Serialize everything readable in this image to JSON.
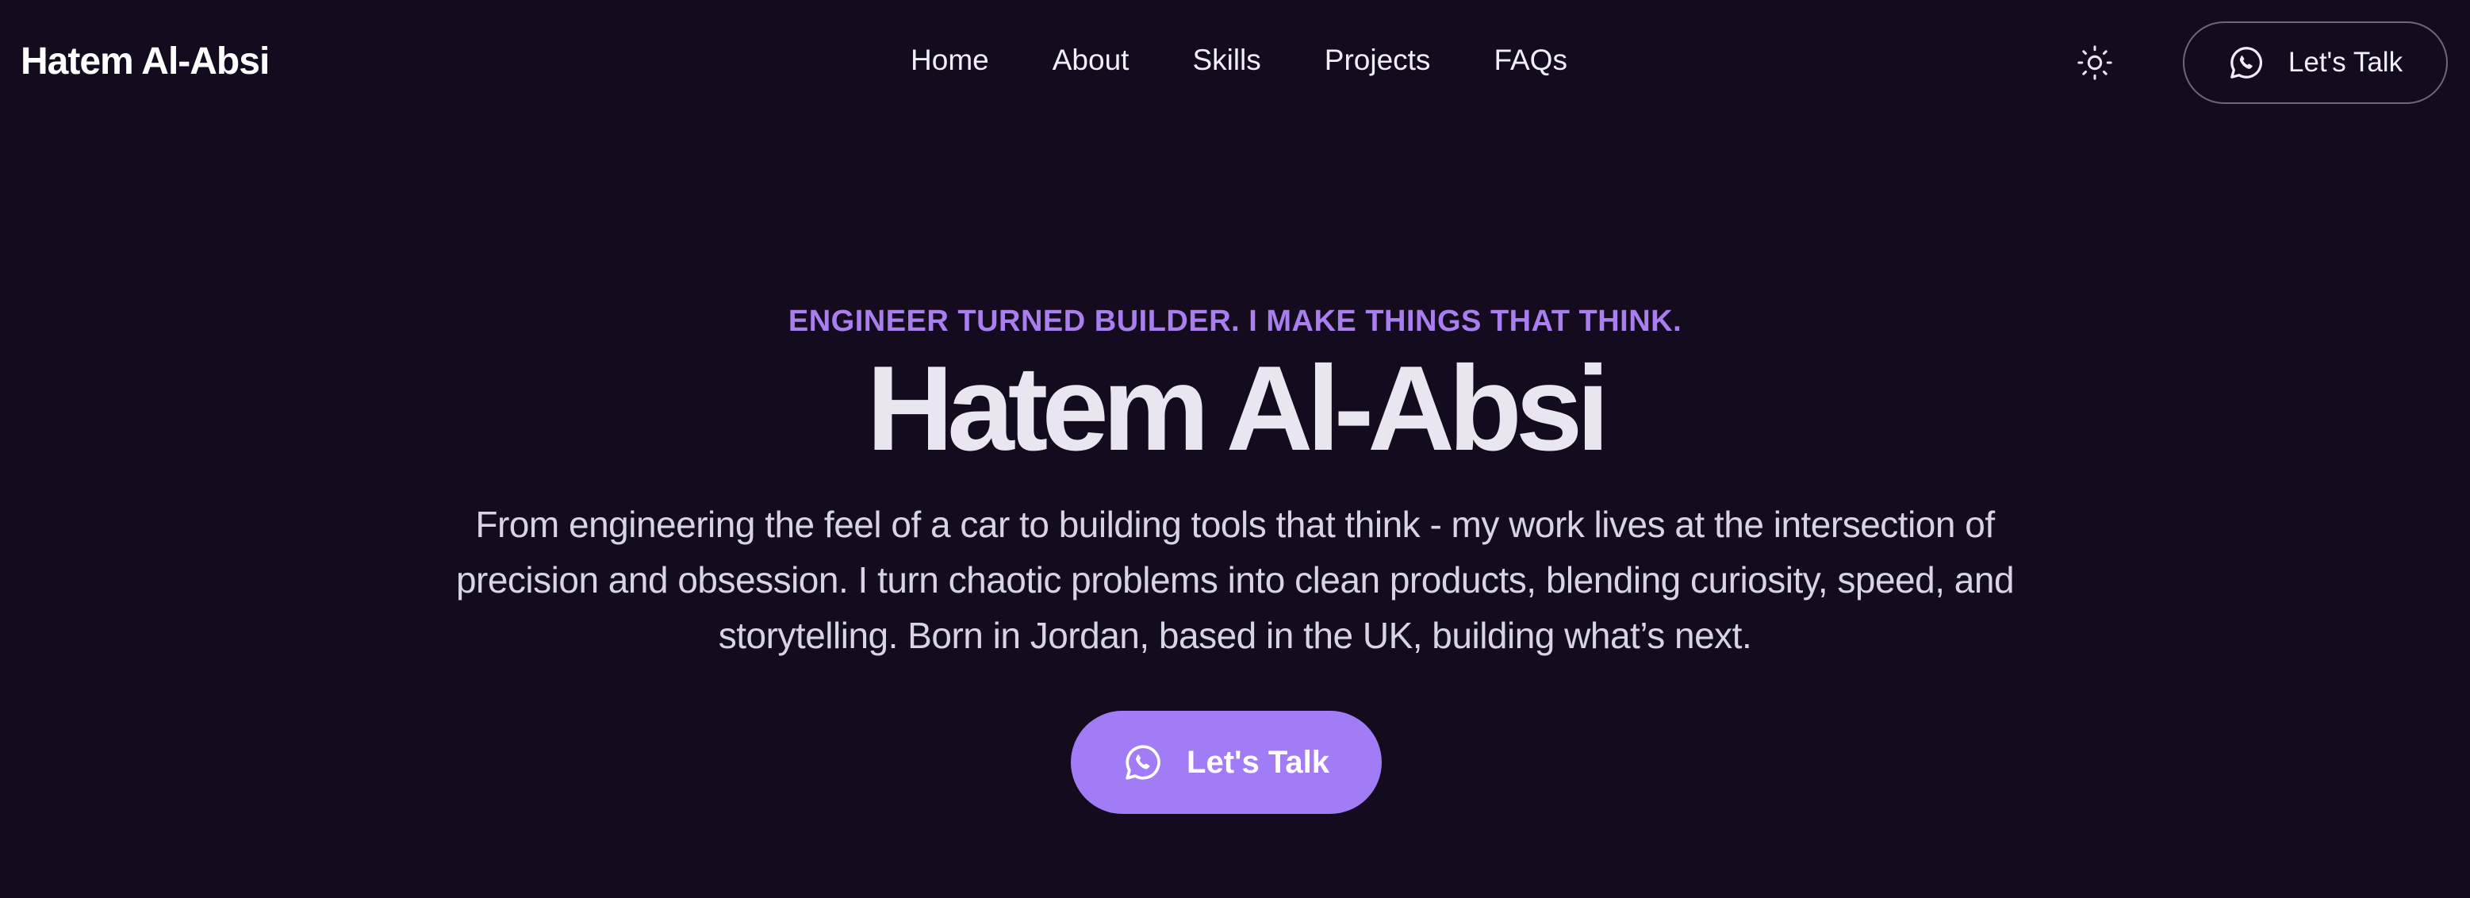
{
  "nav": {
    "brand": "Hatem Al-Absi",
    "links": [
      "Home",
      "About",
      "Skills",
      "Projects",
      "FAQs"
    ],
    "theme_icon": "sun-icon",
    "cta_label": "Let's Talk",
    "cta_icon": "whatsapp-icon"
  },
  "hero": {
    "tagline": "ENGINEER TURNED BUILDER. I MAKE THINGS THAT THINK.",
    "title": "Hatem Al-Absi",
    "description": "From engineering the feel of a car to building tools that think - my work lives at the intersection of precision and obsession. I turn chaotic problems into clean products, blending curiosity, speed, and storytelling. Born in Jordan, based in the UK, building what’s next.",
    "cta_label": "Let's Talk",
    "cta_icon": "whatsapp-icon"
  },
  "colors": {
    "background": "#150b1f",
    "accent": "#a27cf6",
    "tagline": "#a97ff0"
  }
}
